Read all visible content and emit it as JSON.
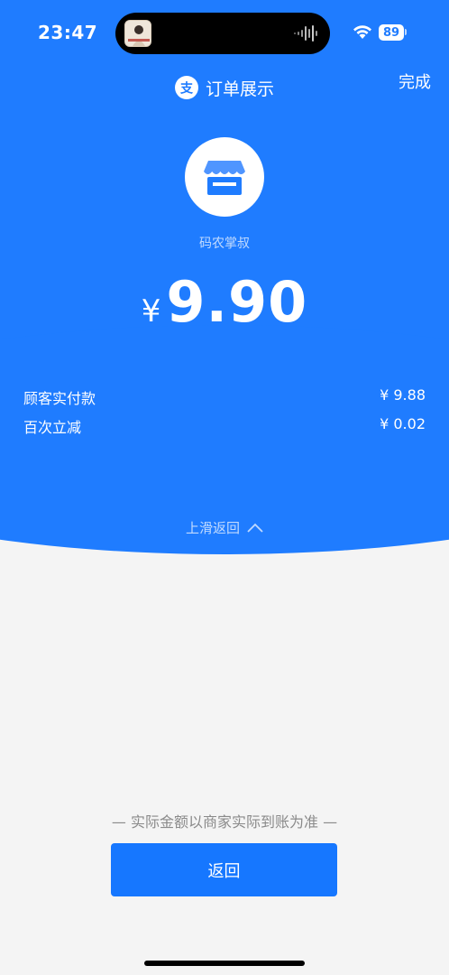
{
  "status_bar": {
    "time": "23:47",
    "battery": "89",
    "wifi_icon": "wifi-icon",
    "audio_icon": "audio-wave-icon"
  },
  "nav": {
    "title": "订单展示",
    "done_label": "完成",
    "brand_icon": "alipay-logo-icon"
  },
  "merchant": {
    "name": "码农掌叔",
    "logo_icon": "shop-storefront-icon"
  },
  "amount": {
    "currency": "¥",
    "value": "9.90"
  },
  "details": [
    {
      "label": "顾客实付款",
      "value": "¥ 9.88"
    },
    {
      "label": "百次立减",
      "value": "¥ 0.02"
    }
  ],
  "swipe_back_label": "上滑返回",
  "disclaimer": "— 实际金额以商家实际到账为准 —",
  "back_button_label": "返回",
  "colors": {
    "primary_blue": "#1f7cff",
    "button_blue": "#1677ff",
    "background": "#f4f4f4"
  }
}
